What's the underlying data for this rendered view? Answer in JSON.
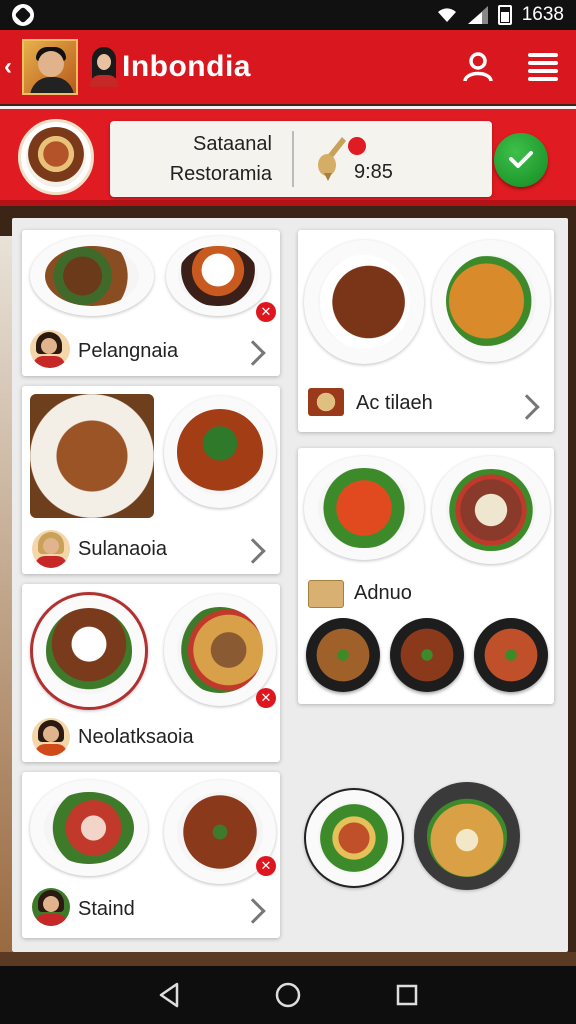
{
  "status_bar": {
    "time": "1638"
  },
  "header": {
    "brand": "Inbondia"
  },
  "info_bar": {
    "title": "Sataanal",
    "subtitle": "Restoramia",
    "price": "9:85"
  },
  "cards": {
    "left": [
      {
        "label": "Pelangnaia"
      },
      {
        "label": "Sulanaoia"
      },
      {
        "label": "Neolatksaoia"
      },
      {
        "label": "Staind"
      }
    ],
    "right": [
      {
        "label": "Ac tilaeh"
      },
      {
        "label": "Adnuo"
      }
    ]
  },
  "colors": {
    "brand_red": "#d8181e",
    "confirm_green": "#1f9e2c",
    "background": "#ececec"
  },
  "icons": [
    "back-chevron-icon",
    "user-icon",
    "menu-icon",
    "check-icon",
    "close-badge-icon",
    "chevron-right-icon",
    "wifi-icon",
    "signal-icon",
    "battery-icon",
    "nav-back-icon",
    "nav-home-icon",
    "nav-recents-icon"
  ]
}
